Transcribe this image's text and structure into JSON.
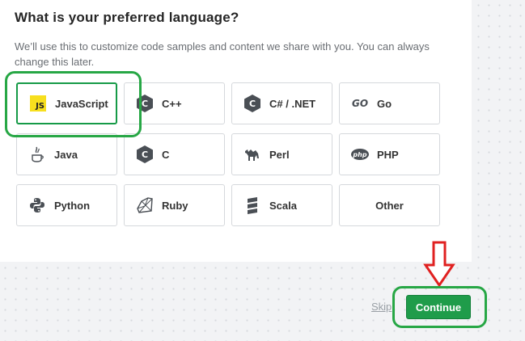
{
  "title": "What is your preferred language?",
  "description": "We’ll use this to customize code samples and content we share with you. You can always change this later.",
  "languages": [
    {
      "label": "JavaScript",
      "icon": "javascript-icon",
      "selected": true
    },
    {
      "label": "C++",
      "icon": "cpp-icon"
    },
    {
      "label": "C# / .NET",
      "icon": "csharp-icon"
    },
    {
      "label": "Go",
      "icon": "go-icon"
    },
    {
      "label": "Java",
      "icon": "java-icon"
    },
    {
      "label": "C",
      "icon": "c-icon"
    },
    {
      "label": "Perl",
      "icon": "perl-camel-icon"
    },
    {
      "label": "PHP",
      "icon": "php-icon"
    },
    {
      "label": "Python",
      "icon": "python-icon"
    },
    {
      "label": "Ruby",
      "icon": "ruby-icon"
    },
    {
      "label": "Scala",
      "icon": "scala-icon"
    },
    {
      "label": "Other",
      "icon": ""
    }
  ],
  "icon_text": {
    "js": "JS",
    "cpp": "C",
    "csharp": "C",
    "go": "GO",
    "c": "C",
    "php": "php"
  },
  "actions": {
    "skip": "Skip",
    "continue": "Continue"
  },
  "colors": {
    "accent": "#1f9c4a",
    "highlight": "#27a745",
    "arrow": "#e02020",
    "js": "#f7df1e"
  }
}
